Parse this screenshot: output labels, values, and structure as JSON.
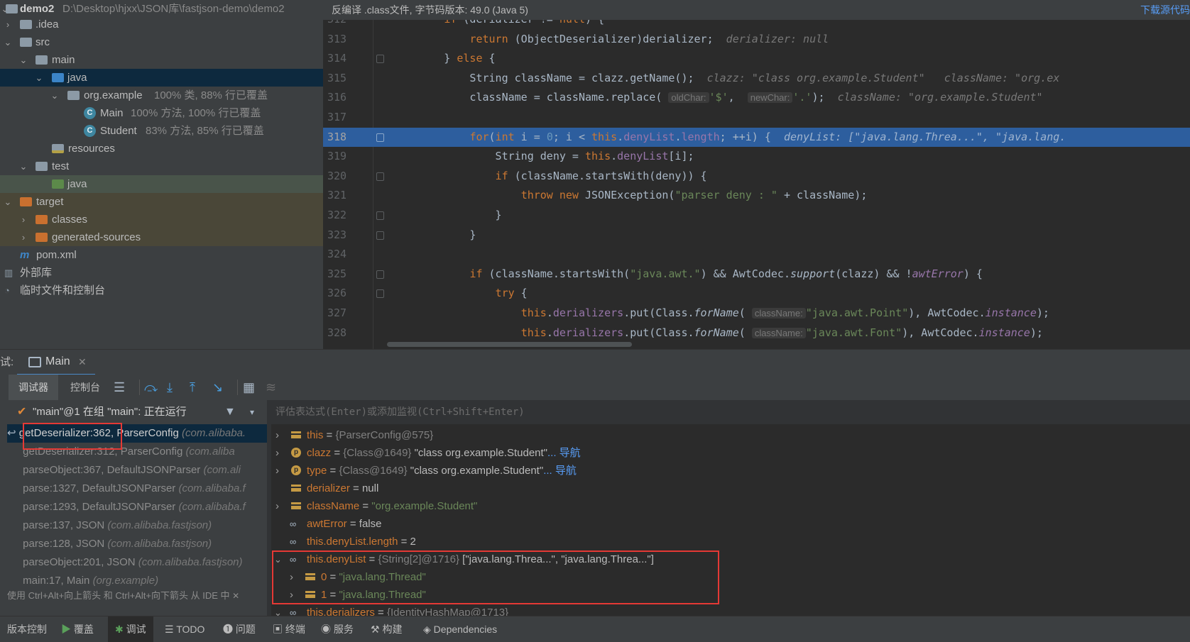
{
  "project": {
    "root_name": "demo2",
    "root_path": "D:\\Desktop\\hjxx\\JSON库\\fastjson-demo\\demo2",
    "items": [
      {
        "label": ".idea"
      },
      {
        "label": "src"
      },
      {
        "label": "main"
      },
      {
        "label": "java"
      },
      {
        "label": "org.example",
        "coverage": "100% 类, 88% 行已覆盖"
      },
      {
        "label": "Main",
        "coverage": "100% 方法, 100% 行已覆盖"
      },
      {
        "label": "Student",
        "coverage": "83% 方法, 85% 行已覆盖"
      },
      {
        "label": "resources"
      },
      {
        "label": "test"
      },
      {
        "label": "java"
      },
      {
        "label": "target"
      },
      {
        "label": "classes"
      },
      {
        "label": "generated-sources"
      },
      {
        "label": "pom.xml"
      },
      {
        "label": "外部库"
      },
      {
        "label": "临时文件和控制台"
      }
    ]
  },
  "editor": {
    "banner": "反编译 .class文件, 字节码版本: 49.0 (Java 5)",
    "download_link": "下载源代码",
    "line_numbers": [
      "312",
      "313",
      "314",
      "315",
      "316",
      "317",
      "318",
      "319",
      "320",
      "321",
      "322",
      "323",
      "324",
      "325",
      "326",
      "327",
      "328"
    ],
    "hints": {
      "derializer_null": "derializer: null",
      "clazz_val": "clazz: \"class org.example.Student\"",
      "classname_trunc": "className: \"org.ex",
      "classname_val": "className: \"org.example.Student\"",
      "denylist_val": "denyList: [\"java.lang.Threa...\", \"java.lang.",
      "oldchar": "oldChar:",
      "newchar": "newChar:",
      "classname_param": "className:"
    }
  },
  "debug": {
    "prefix": "试:",
    "session_tab": "Main",
    "tab_debugger": "调试器",
    "tab_console": "控制台",
    "thread": "\"main\"@1 在组 \"main\": 正在运行",
    "frames": [
      {
        "method": "getDeserializer:362, ParserConfig",
        "pkg": "(com.alibaba."
      },
      {
        "method": "getDeserializer:312, ParserConfig",
        "pkg": "(com.aliba"
      },
      {
        "method": "parseObject:367, DefaultJSONParser",
        "pkg": "(com.ali"
      },
      {
        "method": "parse:1327, DefaultJSONParser",
        "pkg": "(com.alibaba.f"
      },
      {
        "method": "parse:1293, DefaultJSONParser",
        "pkg": "(com.alibaba.f"
      },
      {
        "method": "parse:137, JSON",
        "pkg": "(com.alibaba.fastjson)"
      },
      {
        "method": "parse:128, JSON",
        "pkg": "(com.alibaba.fastjson)"
      },
      {
        "method": "parseObject:201, JSON",
        "pkg": "(com.alibaba.fastjson)"
      },
      {
        "method": "main:17, Main",
        "pkg": "(org.example)"
      }
    ],
    "frames_hint": "使用 Ctrl+Alt+向上箭头 和 Ctrl+Alt+向下箭头 从 IDE 中",
    "eval_placeholder": "评估表达式(Enter)或添加监视(Ctrl+Shift+Enter)",
    "variables": [
      {
        "name": "this",
        "eq": " = ",
        "ref": "{ParserConfig@575}",
        "val": "",
        "link": ""
      },
      {
        "name": "clazz",
        "eq": " = ",
        "ref": "{Class@1649}",
        "val": " \"class org.example.Student\"",
        "link": "... 导航"
      },
      {
        "name": "type",
        "eq": " = ",
        "ref": "{Class@1649}",
        "val": " \"class org.example.Student\"",
        "link": "... 导航"
      },
      {
        "name": "derializer",
        "eq": " = ",
        "ref": "",
        "val": "null",
        "link": ""
      },
      {
        "name": "className",
        "eq": " = ",
        "ref": "",
        "val": "\"org.example.Student\"",
        "link": ""
      },
      {
        "name": "awtError",
        "eq": " = ",
        "ref": "",
        "val": "false",
        "link": ""
      },
      {
        "name": "this.denyList.length",
        "eq": " = ",
        "ref": "",
        "val": "2",
        "link": ""
      },
      {
        "name": "this.denyList",
        "eq": " = ",
        "ref": "{String[2]@1716}",
        "val": " [\"java.lang.Threa...\", \"java.lang.Threa...\"]",
        "link": ""
      },
      {
        "name": "0",
        "eq": " = ",
        "ref": "",
        "val": "\"java.lang.Thread\"",
        "link": ""
      },
      {
        "name": "1",
        "eq": " = ",
        "ref": "",
        "val": "\"java.lang.Thread\"",
        "link": ""
      },
      {
        "name": "this.derializers",
        "eq": " = ",
        "ref": "{IdentityHashMap@1713}",
        "val": "",
        "link": ""
      }
    ]
  },
  "statusbar": {
    "items": [
      "版本控制",
      "覆盖",
      "调试",
      "TODO",
      "问题",
      "终端",
      "服务",
      "构建",
      "Dependencies"
    ]
  },
  "colors": {
    "accent": "#2d5e9e",
    "highlight_box": "#e53935",
    "keyword": "#cc7832",
    "string": "#6a8759"
  }
}
